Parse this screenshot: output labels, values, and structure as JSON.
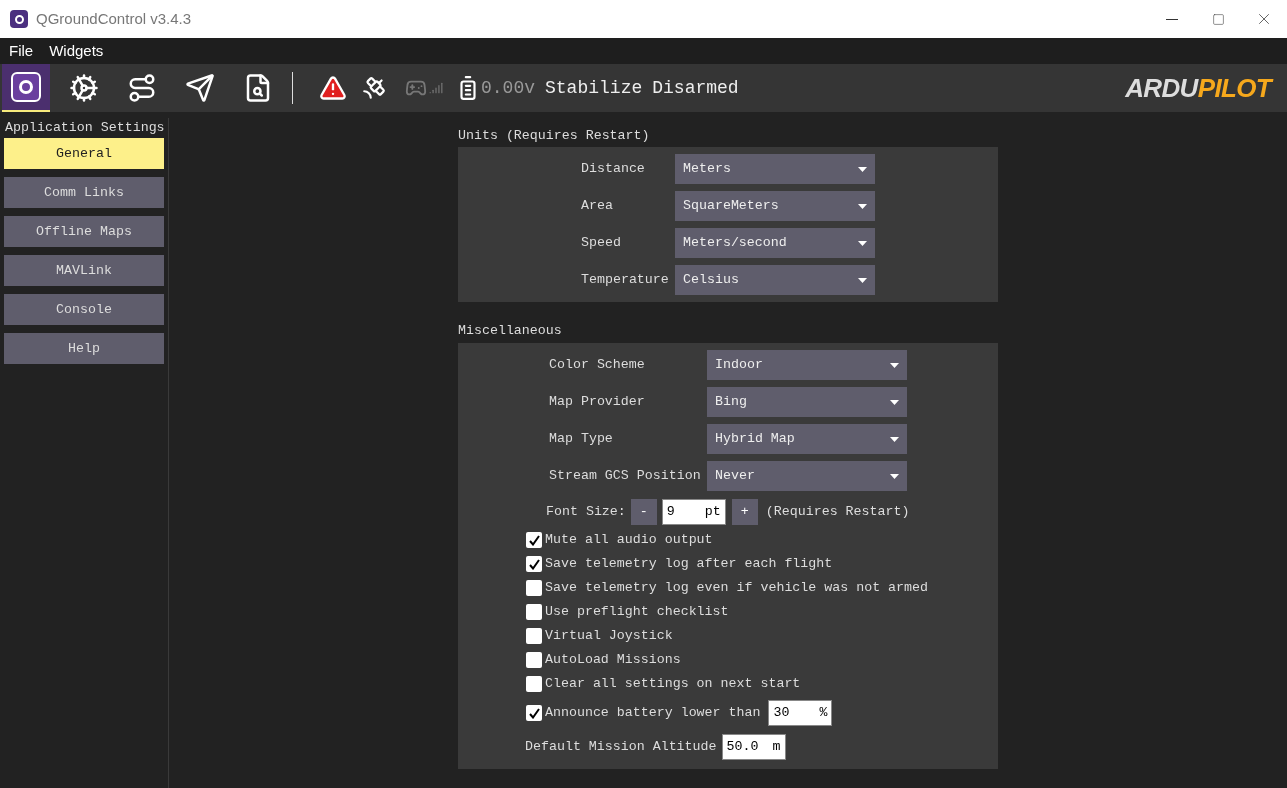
{
  "window": {
    "title": "QGroundControl v3.4.3"
  },
  "menu": [
    "File",
    "Widgets"
  ],
  "toolbar": {
    "tools": [
      {
        "kind": "app",
        "selected": true
      },
      {
        "kind": "setup",
        "selected": false
      },
      {
        "kind": "plan",
        "selected": false
      },
      {
        "kind": "fly",
        "selected": false
      },
      {
        "kind": "analyze",
        "selected": false
      }
    ],
    "voltage": "0.00v",
    "flight_mode": "Stabilize",
    "arm_state": "Disarmed",
    "logo": {
      "part_1": "ARDU",
      "part_2": "PILOT"
    }
  },
  "sidebar": {
    "heading": "Application Settings",
    "items": [
      {
        "label": "General",
        "selected": true
      },
      {
        "label": "Comm Links",
        "selected": false
      },
      {
        "label": "Offline Maps",
        "selected": false
      },
      {
        "label": "MAVLink",
        "selected": false
      },
      {
        "label": "Console",
        "selected": false
      },
      {
        "label": "Help",
        "selected": false
      }
    ]
  },
  "units": {
    "title": "Units (Requires Restart)",
    "rows": [
      {
        "label": "Distance",
        "value": "Meters"
      },
      {
        "label": "Area",
        "value": "SquareMeters"
      },
      {
        "label": "Speed",
        "value": "Meters/second"
      },
      {
        "label": "Temperature",
        "value": "Celsius"
      }
    ]
  },
  "misc": {
    "title": "Miscellaneous",
    "dropdowns": [
      {
        "label": "Color Scheme",
        "value": "Indoor"
      },
      {
        "label": "Map Provider",
        "value": "Bing"
      },
      {
        "label": "Map Type",
        "value": "Hybrid Map"
      },
      {
        "label": "Stream GCS Position",
        "value": "Never"
      }
    ],
    "font_size": {
      "label": "Font Size:",
      "minus": "-",
      "value": "9",
      "unit": "pt",
      "plus": "+",
      "note": "(Requires Restart)"
    },
    "checkboxes": [
      {
        "label": "Mute all audio output",
        "checked": true
      },
      {
        "label": "Save telemetry log after each flight",
        "checked": true
      },
      {
        "label": "Save telemetry log even if vehicle was not armed",
        "checked": false
      },
      {
        "label": "Use preflight checklist",
        "checked": false
      },
      {
        "label": "Virtual Joystick",
        "checked": false
      },
      {
        "label": "AutoLoad Missions",
        "checked": false
      },
      {
        "label": "Clear all settings on next start",
        "checked": false
      }
    ],
    "battery": {
      "label": "Announce battery lower than",
      "checked": true,
      "value": "30",
      "unit": "%"
    },
    "altitude": {
      "label": "Default Mission Altitude",
      "value": "50.0",
      "unit": "m"
    }
  }
}
